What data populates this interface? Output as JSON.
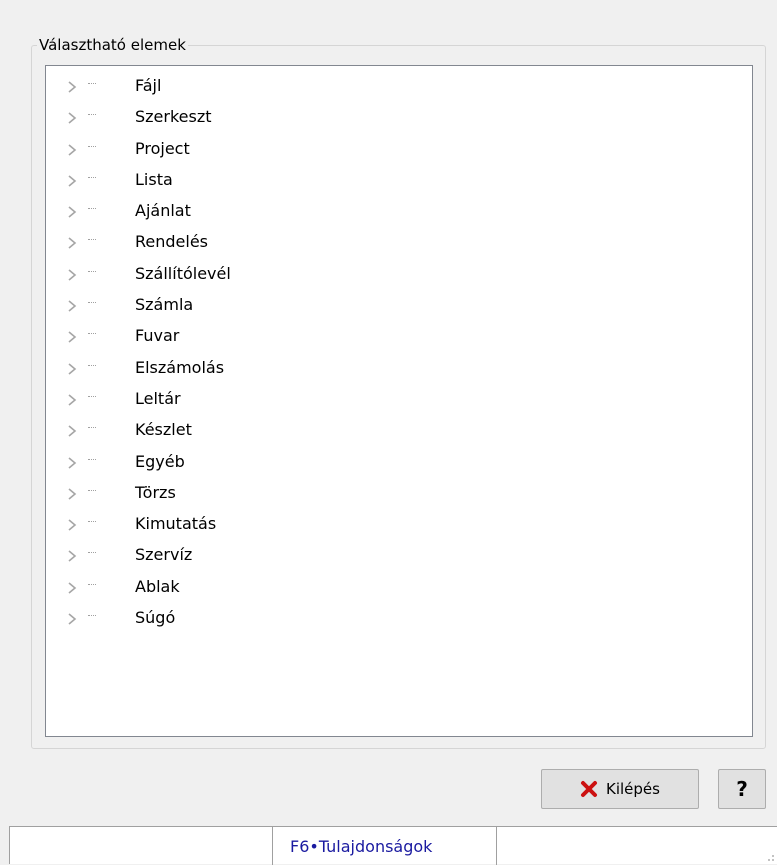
{
  "group": {
    "title": "Választható elemek"
  },
  "tree": {
    "items": [
      {
        "label": "Fájl"
      },
      {
        "label": "Szerkeszt"
      },
      {
        "label": "Project"
      },
      {
        "label": "Lista"
      },
      {
        "label": "Ajánlat"
      },
      {
        "label": "Rendelés"
      },
      {
        "label": "Szállítólevél"
      },
      {
        "label": "Számla"
      },
      {
        "label": "Fuvar"
      },
      {
        "label": "Elszámolás"
      },
      {
        "label": "Leltár"
      },
      {
        "label": "Készlet"
      },
      {
        "label": "Egyéb"
      },
      {
        "label": "Törzs"
      },
      {
        "label": "Kimutatás"
      },
      {
        "label": "Szervíz"
      },
      {
        "label": "Ablak"
      },
      {
        "label": "Súgó"
      }
    ]
  },
  "buttons": {
    "exit_label": "Kilépés",
    "exit_icon": "red-x-icon",
    "help_label": "?"
  },
  "statusbar": {
    "text": "F6•Tulajdonságok"
  },
  "colors": {
    "status_text": "#1a1aa0",
    "exit_icon": "#cc1111"
  }
}
